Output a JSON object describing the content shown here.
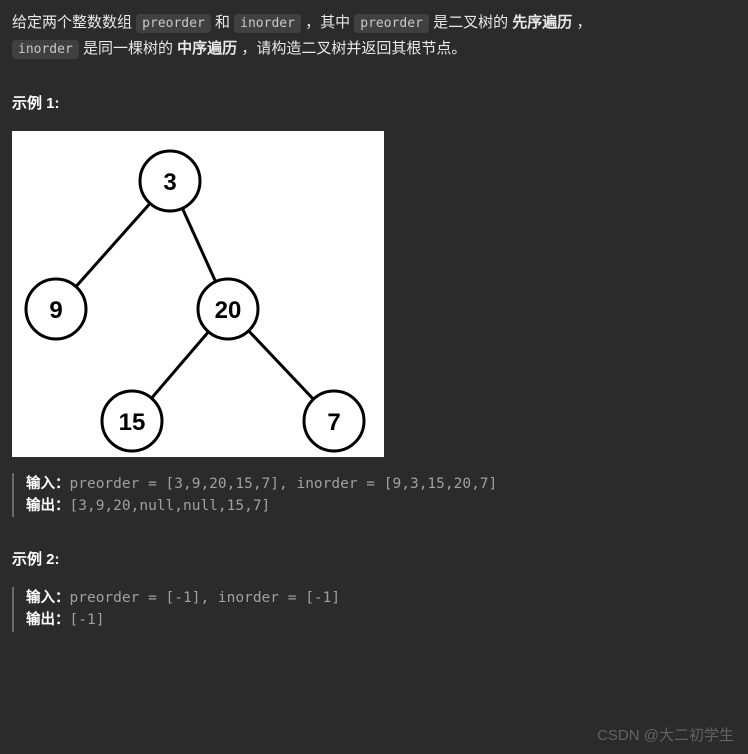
{
  "description": {
    "p1_a": "给定两个整数数组 ",
    "code1": "preorder",
    "p1_b": " 和 ",
    "code2": "inorder",
    "p1_c": " ，其中 ",
    "code3": "preorder",
    "p1_d": " 是二叉树的",
    "bold1": "先序遍历",
    "p1_e": "，",
    "code4": "inorder",
    "p2_a": " 是同一棵树的",
    "bold2": "中序遍历",
    "p2_b": "，请构造二叉树并返回其根节点。"
  },
  "example1": {
    "heading": "示例 1:",
    "input_label": "输入：",
    "input_value": "preorder = [3,9,20,15,7], inorder = [9,3,15,20,7]",
    "output_label": "输出：",
    "output_value": "[3,9,20,null,null,15,7]"
  },
  "example2": {
    "heading": "示例 2:",
    "input_label": "输入：",
    "input_value": "preorder = [-1], inorder = [-1]",
    "output_label": "输出：",
    "output_value": "[-1]"
  },
  "tree": {
    "nodes": {
      "root": "3",
      "left": "9",
      "right": "20",
      "right_left": "15",
      "right_right": "7"
    }
  },
  "watermark": "CSDN @大二初学生",
  "chart_data": {
    "type": "diagram",
    "structure": "binary-tree",
    "edges": [
      [
        "3",
        "9"
      ],
      [
        "3",
        "20"
      ],
      [
        "20",
        "15"
      ],
      [
        "20",
        "7"
      ]
    ],
    "nodes": [
      "3",
      "9",
      "20",
      "15",
      "7"
    ]
  }
}
